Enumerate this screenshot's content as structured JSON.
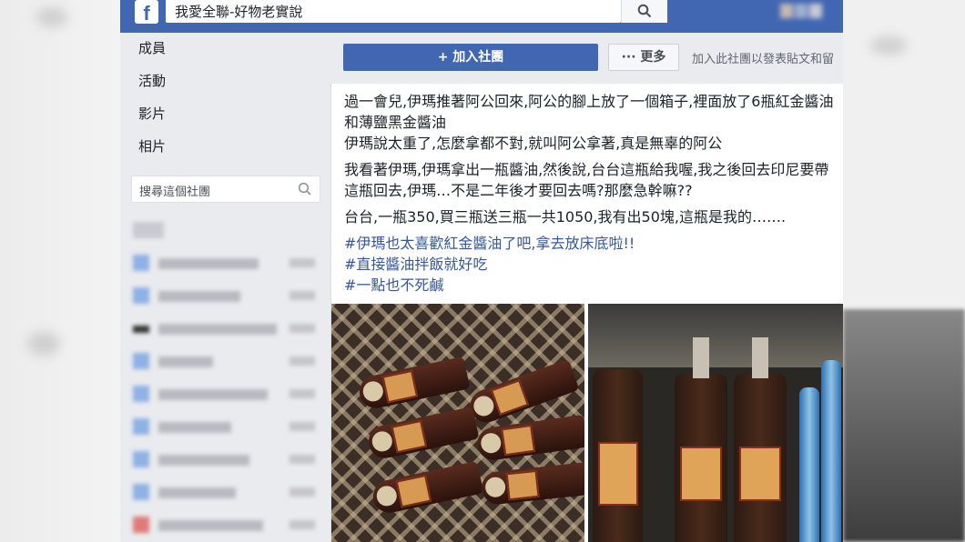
{
  "topbar": {
    "logo": "f",
    "search_value": "我愛全聯-好物老實說"
  },
  "nav": {
    "items": [
      {
        "label": "成員"
      },
      {
        "label": "活動"
      },
      {
        "label": "影片"
      },
      {
        "label": "相片"
      }
    ],
    "group_search_placeholder": "搜尋這個社團"
  },
  "actions": {
    "join_label": "+ 加入社團",
    "more_label": "··· 更多",
    "join_hint": "加入此社團以發表貼文和留"
  },
  "post": {
    "paragraphs": [
      "過一會兒,伊瑪推著阿公回來,阿公的腳上放了一個箱子,裡面放了6瓶紅金醬油和薄鹽黑金醬油",
      "伊瑪說太重了,怎麼拿都不對,就叫阿公拿著,真是無辜的阿公",
      "我看著伊瑪,伊瑪拿出一瓶醬油,然後說,台台這瓶給我喔,我之後回去印尼要帶這瓶回去,伊瑪…不是二年後才要回去嗎?那麼急幹嘛??",
      "台台,一瓶350,買三瓶送三瓶一共1050,我有出50塊,這瓶是我的……."
    ],
    "hashtags": [
      "#伊瑪也太喜歡紅金醬油了吧,拿去放床底啦!!",
      "#直接醬油拌飯就好吃",
      "#一點也不死鹹"
    ]
  },
  "colors": {
    "brand": "#4267b2",
    "link": "#365899",
    "background": "#e9ebee"
  },
  "icons": {
    "search": "search-icon",
    "logo": "facebook-logo-icon"
  }
}
